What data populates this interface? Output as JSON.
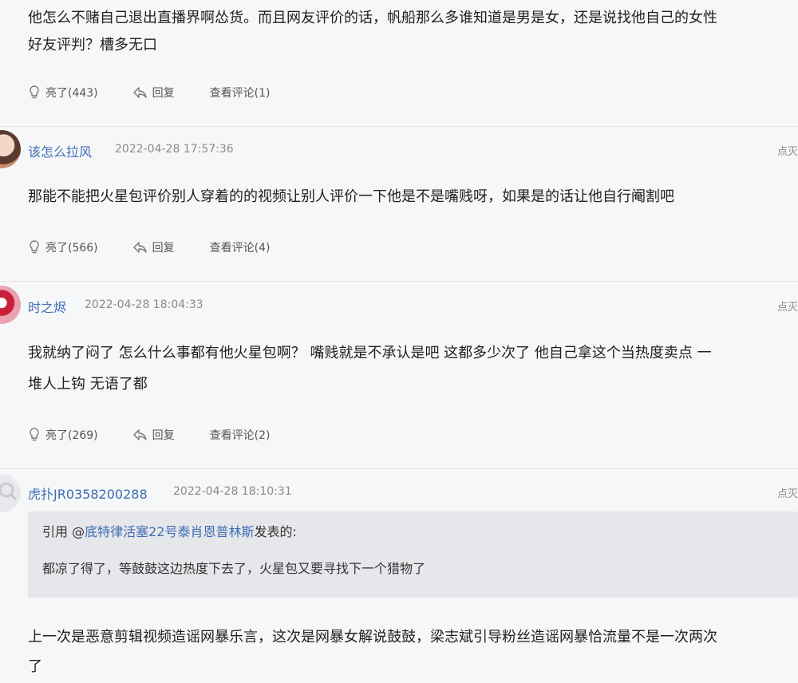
{
  "comments": [
    {
      "text_lines": [
        "他怎么不赌自己退出直播界啊怂货。而且网友评价的话，帆船那么多谁知道是男是女，还是说找他自己的女性",
        "好友评判？槽多无口"
      ],
      "like": "亮了(443)",
      "reply": "回复",
      "view": "查看评论(1)"
    },
    {
      "user": "该怎么拉风",
      "time": "2022-04-28 17:57:36",
      "report": "点灭",
      "text_lines": [
        "那能不能把火星包评价别人穿着的的视频让别人评价一下他是不是嘴贱呀，如果是的话让他自行阉割吧"
      ],
      "like": "亮了(566)",
      "reply": "回复",
      "view": "查看评论(4)"
    },
    {
      "user": "时之烬",
      "time": "2022-04-28 18:04:33",
      "report": "点灭",
      "text_lines": [
        "我就纳了闷了 怎么什么事都有他火星包啊？ 嘴贱就是不承认是吧 这都多少次了 他自己拿这个当热度卖点 一",
        "堆人上钩 无语了都"
      ],
      "like": "亮了(269)",
      "reply": "回复",
      "view": "查看评论(2)"
    },
    {
      "user": "虎扑JR0358200288",
      "time": "2022-04-28 18:10:31",
      "report": "点灭",
      "quote_prefix": "引用 @",
      "quote_user": "底特律活塞22号泰肖恩普林斯",
      "quote_suffix": "发表的:",
      "quote_text": "都凉了得了，等鼓鼓这边热度下去了，火星包又要寻找下一个猎物了",
      "text_lines": [
        "上一次是恶意剪辑视频造谣网暴乐言，这次是网暴女解说鼓鼓，梁志斌引导粉丝造谣网暴恰流量不是一次两次",
        "了"
      ]
    }
  ]
}
